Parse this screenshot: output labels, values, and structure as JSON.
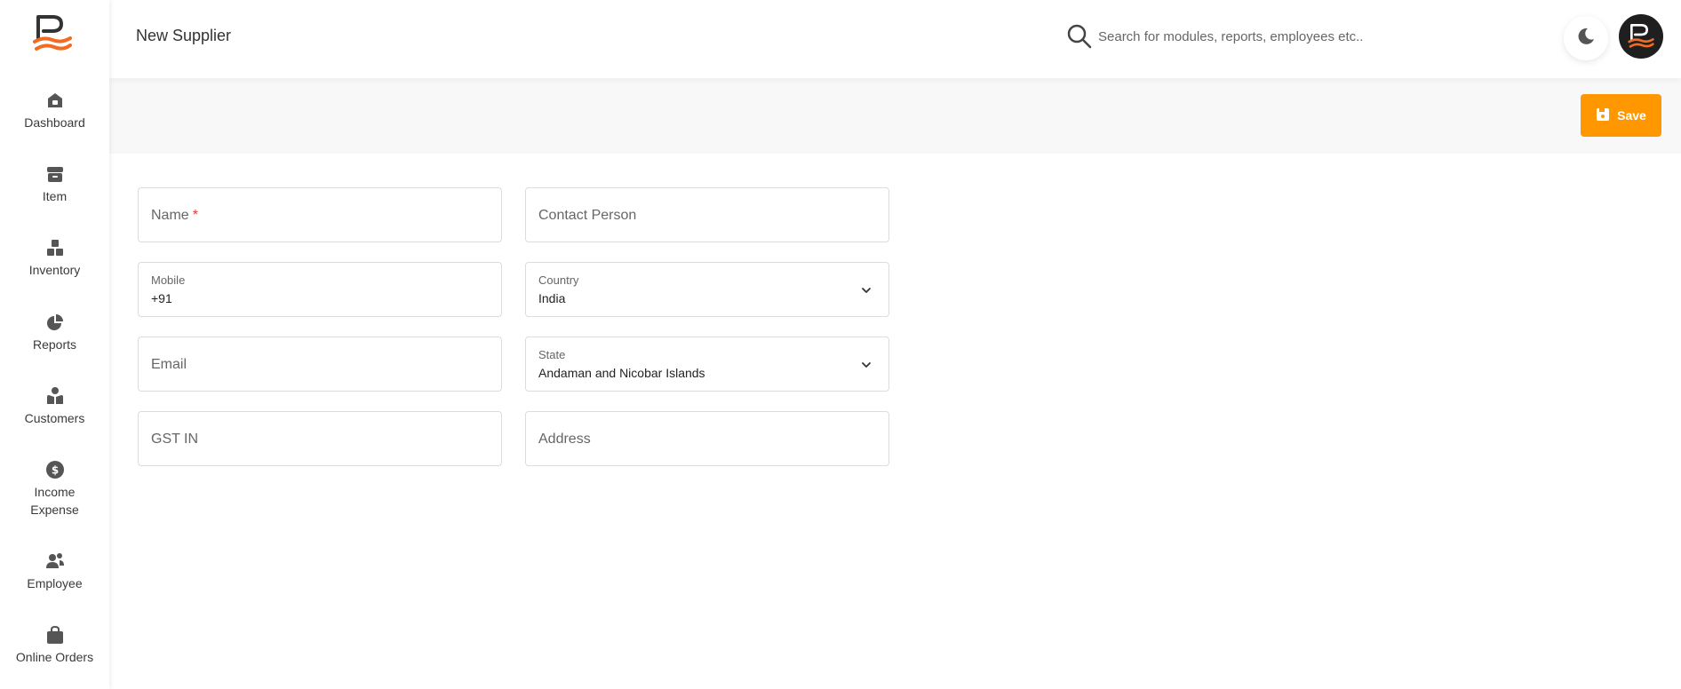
{
  "app": {
    "page_title": "New Supplier"
  },
  "sidebar": {
    "items": [
      {
        "label": "Dashboard",
        "icon": "home-icon"
      },
      {
        "label": "Item",
        "icon": "archive-box-icon"
      },
      {
        "label": "Inventory",
        "icon": "boxes-icon"
      },
      {
        "label": "Reports",
        "icon": "pie-chart-icon"
      },
      {
        "label": "Customers",
        "icon": "customers-icon"
      },
      {
        "label": "Income\nExpense",
        "icon": "dollar-circle-icon"
      },
      {
        "label": "Employee",
        "icon": "users-icon"
      },
      {
        "label": "Online Orders",
        "icon": "shopping-bag-icon"
      }
    ]
  },
  "search": {
    "placeholder": "Search for modules, reports, employees etc.."
  },
  "toolbar": {
    "save_label": "Save"
  },
  "form": {
    "name": {
      "placeholder": "Name",
      "required_mark": "*"
    },
    "contact_person": {
      "placeholder": "Contact Person"
    },
    "mobile": {
      "label": "Mobile",
      "value": "+91"
    },
    "country": {
      "label": "Country",
      "value": "India"
    },
    "email": {
      "placeholder": "Email"
    },
    "state": {
      "label": "State",
      "value": "Andaman and Nicobar Islands"
    },
    "gstin": {
      "placeholder": "GST IN"
    },
    "address": {
      "placeholder": "Address"
    }
  },
  "colors": {
    "accent": "#ff9800",
    "logo_orange": "#f26b21",
    "sidebar_icon": "#555555",
    "required": "#e53935"
  }
}
